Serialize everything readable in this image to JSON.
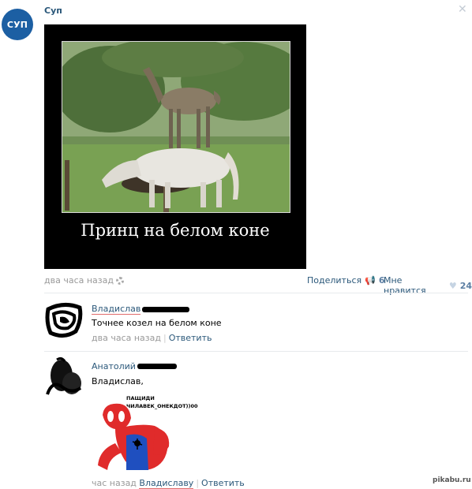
{
  "post": {
    "group_avatar_text": "СУП",
    "group_name": "Суп",
    "image_caption": "Принц на белом коне",
    "time": "два часа назад",
    "share_label": "Поделиться",
    "share_count": "6",
    "dislike_label": "Мне нравится",
    "dislike_count": "24"
  },
  "comments": [
    {
      "author": "Владислав",
      "text": "Точнее козел на белом коне",
      "time": "два часа назад",
      "reply_label": "Ответить"
    },
    {
      "author": "Анатолий",
      "text": "Владислав,",
      "meme_text_line1": "ПАЩИДИ",
      "meme_text_line2": "ЧИЛАВЕК_ОНЕКДОТ))00",
      "time": "час назад",
      "reply_to": "Владиславу",
      "reply_label": "Ответить"
    }
  ],
  "watermark": "pikabu.ru"
}
